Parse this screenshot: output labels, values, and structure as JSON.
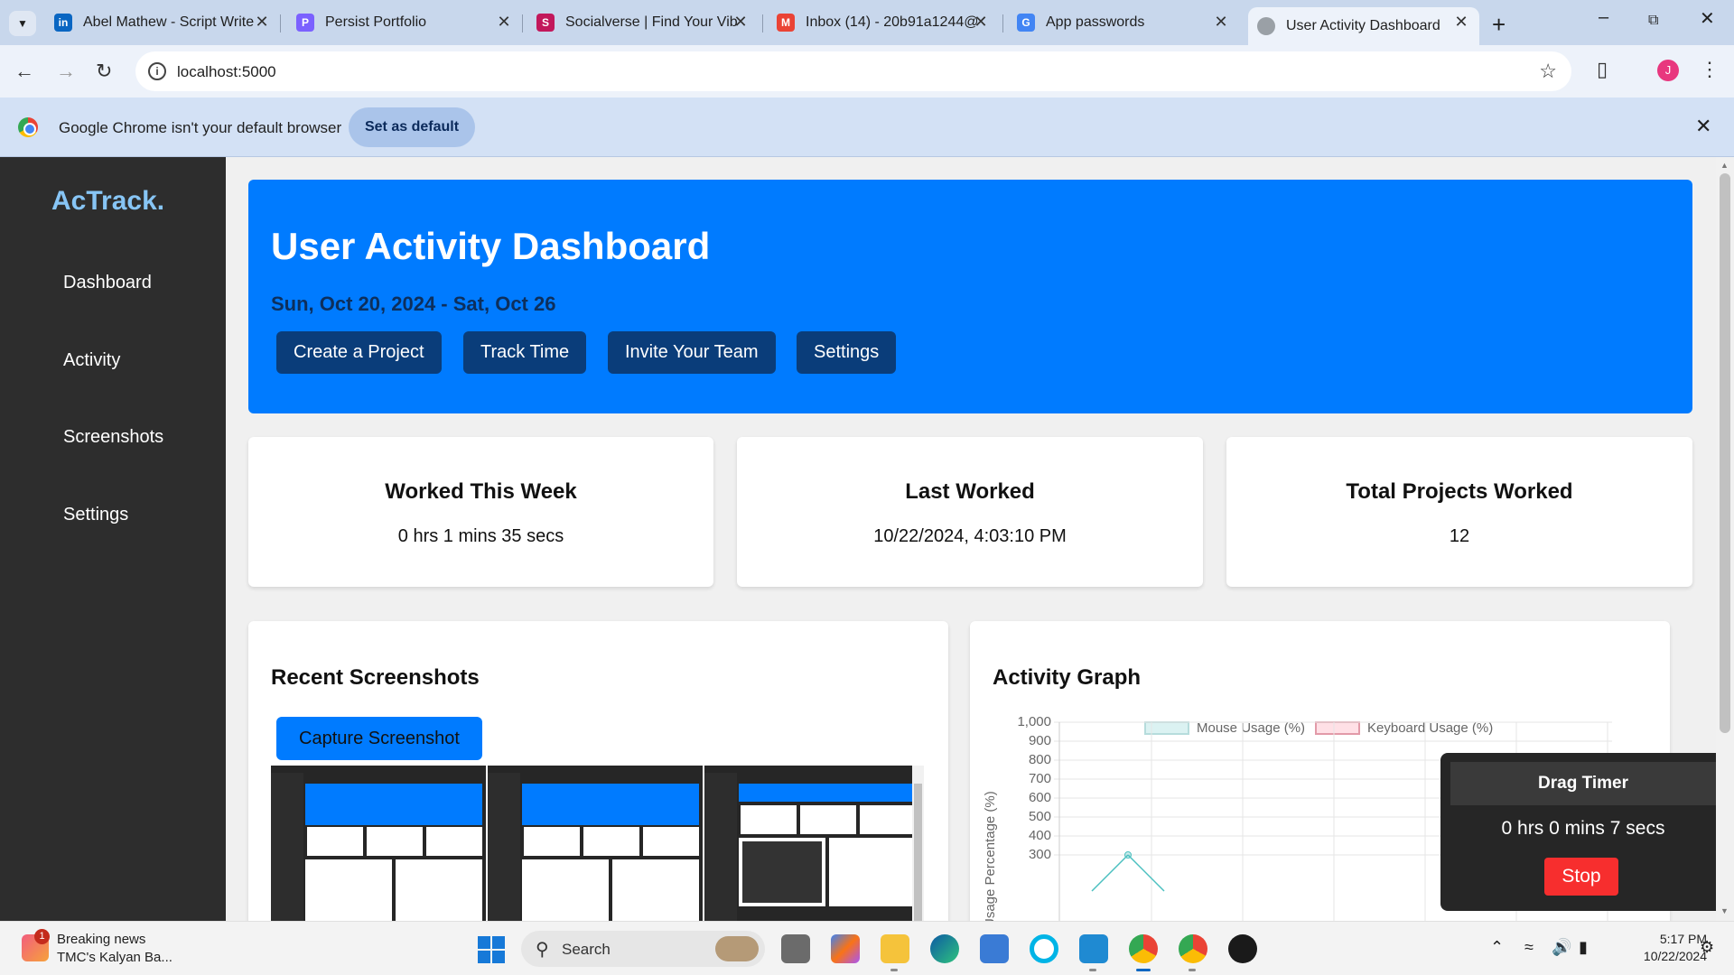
{
  "browser": {
    "tabs": [
      {
        "title": "Abel Mathew - Script Writer",
        "icon": "linkedin-icon",
        "color": "#0a66c2"
      },
      {
        "title": "Persist Portfolio",
        "icon": "persist-icon",
        "color": "#7b61ff"
      },
      {
        "title": "Socialverse | Find Your Vibe",
        "icon": "socialverse-icon",
        "color": "#c2185b"
      },
      {
        "title": "Inbox (14) - 20b91a1244@",
        "icon": "gmail-icon",
        "color": "#ea4335"
      },
      {
        "title": "App passwords",
        "icon": "google-icon",
        "color": "#4285f4"
      },
      {
        "title": "User Activity Dashboard",
        "icon": "globe-icon",
        "color": "#9aa0a6"
      }
    ],
    "url": "localhost:5000",
    "profile_initial": "J",
    "infobar": {
      "message": "Google Chrome isn't your default browser",
      "button": "Set as default"
    }
  },
  "app": {
    "brand": "AcTrack.",
    "nav": [
      "Dashboard",
      "Activity",
      "Screenshots",
      "Settings"
    ],
    "header": {
      "title": "User Activity Dashboard",
      "date_range": "Sun, Oct 20, 2024 - Sat, Oct 26",
      "buttons": [
        "Create a Project",
        "Track Time",
        "Invite Your Team",
        "Settings"
      ]
    },
    "stats": [
      {
        "title": "Worked This Week",
        "value": "0 hrs 1 mins 35 secs"
      },
      {
        "title": "Last Worked",
        "value": "10/22/2024, 4:03:10 PM"
      },
      {
        "title": "Total Projects Worked",
        "value": "12"
      }
    ],
    "screenshots": {
      "title": "Recent Screenshots",
      "button": "Capture Screenshot",
      "count_visible": 3
    },
    "activity_graph": {
      "title": "Activity Graph"
    },
    "timer": {
      "title": "Drag Timer",
      "value": "0 hrs 0 mins 7 secs",
      "button": "Stop"
    },
    "colors": {
      "primary": "#007bff",
      "sidebar": "#2d2d2d",
      "brand": "#87c5f5",
      "stop": "#f72e2e",
      "hero_button": "#0a3d7a"
    }
  },
  "chart_data": {
    "type": "line",
    "title": "Activity Graph",
    "ylabel": "Usage Percentage (%)",
    "legend": [
      "Mouse Usage (%)",
      "Keyboard Usage (%)"
    ],
    "legend_colors": {
      "Mouse Usage (%)": "#4bc0c0",
      "Keyboard Usage (%)": "#ff6384"
    },
    "legend_position": "top",
    "y_ticks": [
      "1,000",
      "900",
      "800",
      "700",
      "600",
      "500",
      "400",
      "300"
    ],
    "ylim": [
      0,
      1000
    ],
    "grid": true,
    "series": [
      {
        "name": "Mouse Usage (%)",
        "visible_points": [
          300
        ]
      }
    ]
  },
  "taskbar": {
    "news_title": "Breaking news",
    "news_sub": "TMC's Kalyan Ba...",
    "news_badge": "1",
    "search_label": "Search",
    "time": "5:17 PM",
    "date": "10/22/2024"
  }
}
